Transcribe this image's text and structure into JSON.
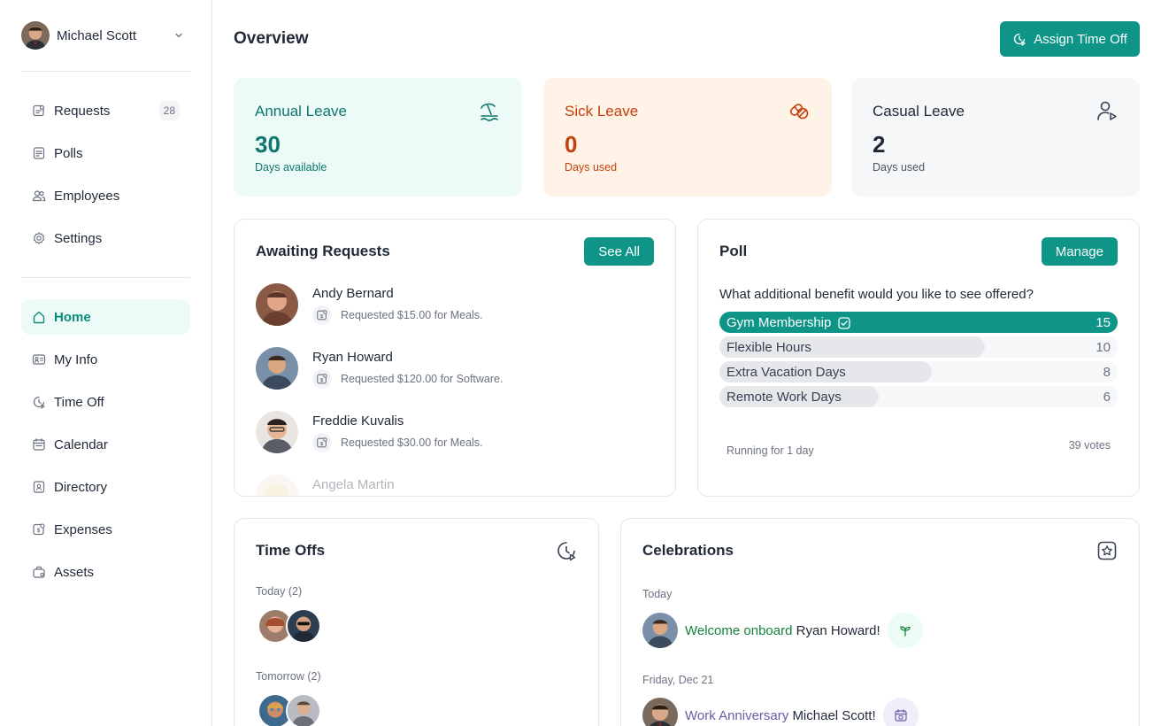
{
  "user": {
    "name": "Michael Scott"
  },
  "nav_top": [
    {
      "label": "Requests",
      "icon": "requests-icon",
      "badge": "28"
    },
    {
      "label": "Polls",
      "icon": "polls-icon"
    },
    {
      "label": "Employees",
      "icon": "employees-icon"
    },
    {
      "label": "Settings",
      "icon": "settings-icon"
    }
  ],
  "nav_main": [
    {
      "label": "Home",
      "icon": "home-icon",
      "active": true
    },
    {
      "label": "My Info",
      "icon": "my-info-icon"
    },
    {
      "label": "Time Off",
      "icon": "time-off-icon"
    },
    {
      "label": "Calendar",
      "icon": "calendar-icon"
    },
    {
      "label": "Directory",
      "icon": "directory-icon"
    },
    {
      "label": "Expenses",
      "icon": "expenses-icon"
    },
    {
      "label": "Assets",
      "icon": "assets-icon"
    }
  ],
  "header": {
    "title": "Overview",
    "assign_label": "Assign Time Off"
  },
  "stats": [
    {
      "title": "Annual Leave",
      "value": "30",
      "sub": "Days available",
      "icon": "beach-icon"
    },
    {
      "title": "Sick Leave",
      "value": "0",
      "sub": "Days used",
      "icon": "pills-icon"
    },
    {
      "title": "Casual Leave",
      "value": "2",
      "sub": "Days used",
      "icon": "user-play-icon"
    }
  ],
  "requests": {
    "title": "Awaiting Requests",
    "see_all": "See All",
    "items": [
      {
        "name": "Andy Bernard",
        "desc": "Requested $15.00 for Meals."
      },
      {
        "name": "Ryan Howard",
        "desc": "Requested $120.00 for Software."
      },
      {
        "name": "Freddie Kuvalis",
        "desc": "Requested $30.00 for Meals."
      },
      {
        "name": "Angela Martin",
        "desc": ""
      }
    ]
  },
  "poll": {
    "title": "Poll",
    "manage": "Manage",
    "question": "What additional benefit would you like to see offered?",
    "options": [
      {
        "label": "Gym Membership",
        "count": 15,
        "selected": true
      },
      {
        "label": "Flexible Hours",
        "count": 10
      },
      {
        "label": "Extra Vacation Days",
        "count": 8
      },
      {
        "label": "Remote Work Days",
        "count": 6
      }
    ],
    "running": "Running for 1 day",
    "votes": "39 votes"
  },
  "timeoffs": {
    "title": "Time Offs",
    "today": "Today (2)",
    "tomorrow": "Tomorrow (2)"
  },
  "celebrations": {
    "title": "Celebrations",
    "today": "Today",
    "item1": {
      "highlight": "Welcome onboard",
      "name": "Ryan Howard!"
    },
    "friday": "Friday, Dec 21",
    "item2": {
      "highlight": "Work Anniversary",
      "name": "Michael Scott!"
    }
  },
  "colors": {
    "accent": "#0f9488",
    "annual_bg": "#ecfbf7",
    "sick_bg": "#fef3e6",
    "casual_bg": "#f6f7f9"
  }
}
